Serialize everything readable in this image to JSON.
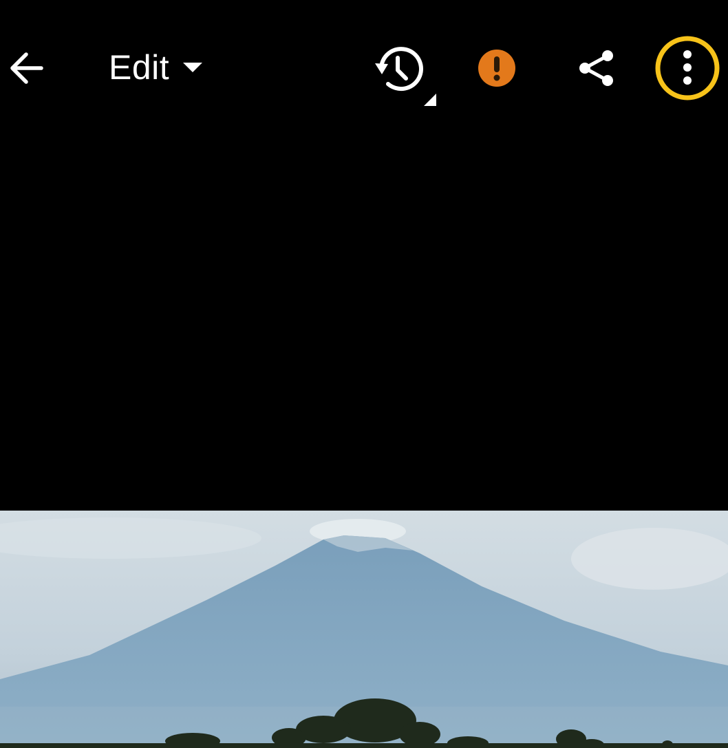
{
  "toolbar": {
    "edit_label": "Edit"
  },
  "icons": {
    "back": "arrow-left-icon",
    "edit_dropdown": "caret-down-icon",
    "history": "history-icon",
    "alert": "exclamation-icon",
    "share": "share-icon",
    "more": "more-vertical-icon"
  },
  "colors": {
    "background": "#000000",
    "icon": "#ffffff",
    "alert": "#e3791b",
    "highlight_ring": "#f7c31a",
    "sky": "#c9d6de",
    "mountain": "#86a8c2"
  }
}
